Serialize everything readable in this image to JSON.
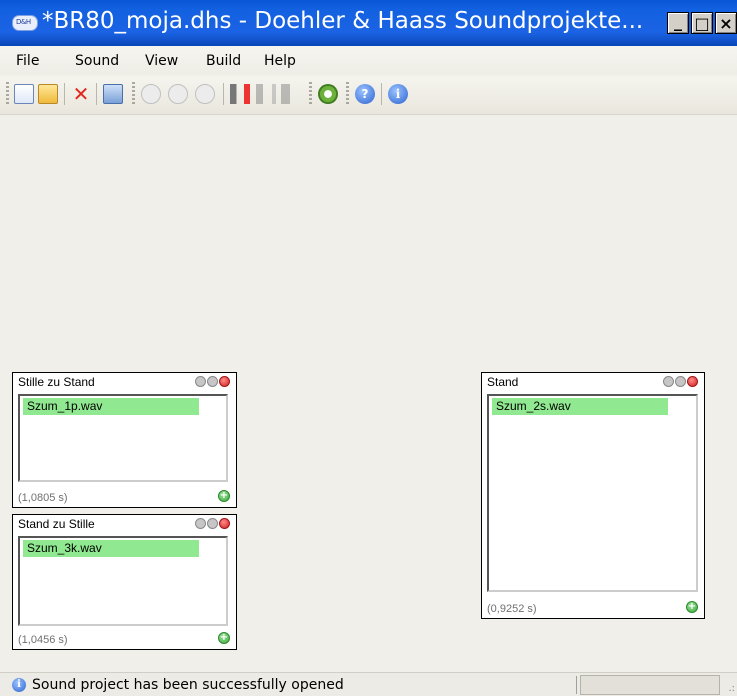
{
  "window": {
    "icon_text": "D&H",
    "title": "*BR80_moja.dhs - Doehler & Haass Soundprojekte...",
    "controls": [
      "_",
      "□",
      "×"
    ]
  },
  "menu": {
    "items": [
      "File",
      "Sound",
      "View",
      "Build",
      "Help"
    ]
  },
  "toolbar": {
    "icons": [
      "new-file-icon",
      "open-folder-icon",
      "delete-icon",
      "save-icon",
      "play-icon",
      "loop-icon",
      "stop-icon",
      "speaker-red-icon",
      "speaker-gray-icon",
      "speaker-dim-icon",
      "build-gear-icon",
      "help-icon",
      "info-icon"
    ]
  },
  "panels": [
    {
      "title": "Stille zu Stand",
      "file": "Szum_1p.wav",
      "duration": "(1,0805 s)"
    },
    {
      "title": "Stand zu Stille",
      "file": "Szum_3k.wav",
      "duration": "(1,0456 s)"
    },
    {
      "title": "Stand",
      "file": "Szum_2s.wav",
      "duration": "(0,9252 s)"
    }
  ],
  "status": {
    "message": "Sound project has been successfully opened"
  },
  "colors": {
    "title_bar": "#1b63e4",
    "list_item_highlight": "#90e890"
  }
}
